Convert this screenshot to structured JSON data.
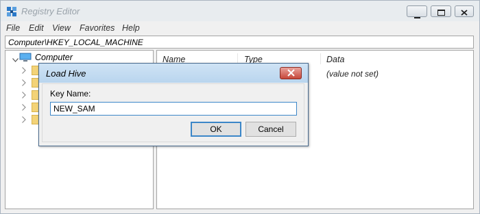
{
  "window": {
    "title": "Registry Editor",
    "app_icon": "registry-icon",
    "controls": [
      "minimize-icon",
      "maximize-icon",
      "close-icon"
    ]
  },
  "menu": [
    "File",
    "Edit",
    "View",
    "Favorites",
    "Help"
  ],
  "address": "Computer\\HKEY_LOCAL_MACHINE",
  "tree": {
    "root_label": "Computer",
    "child_count": 5
  },
  "list": {
    "columns": [
      "Name",
      "Type",
      "Data"
    ],
    "row": {
      "data": "(value not set)"
    }
  },
  "dialog": {
    "title": "Load Hive",
    "key_label": "Key Name:",
    "key_value": "NEW_SAM",
    "ok_label": "OK",
    "cancel_label": "Cancel"
  }
}
